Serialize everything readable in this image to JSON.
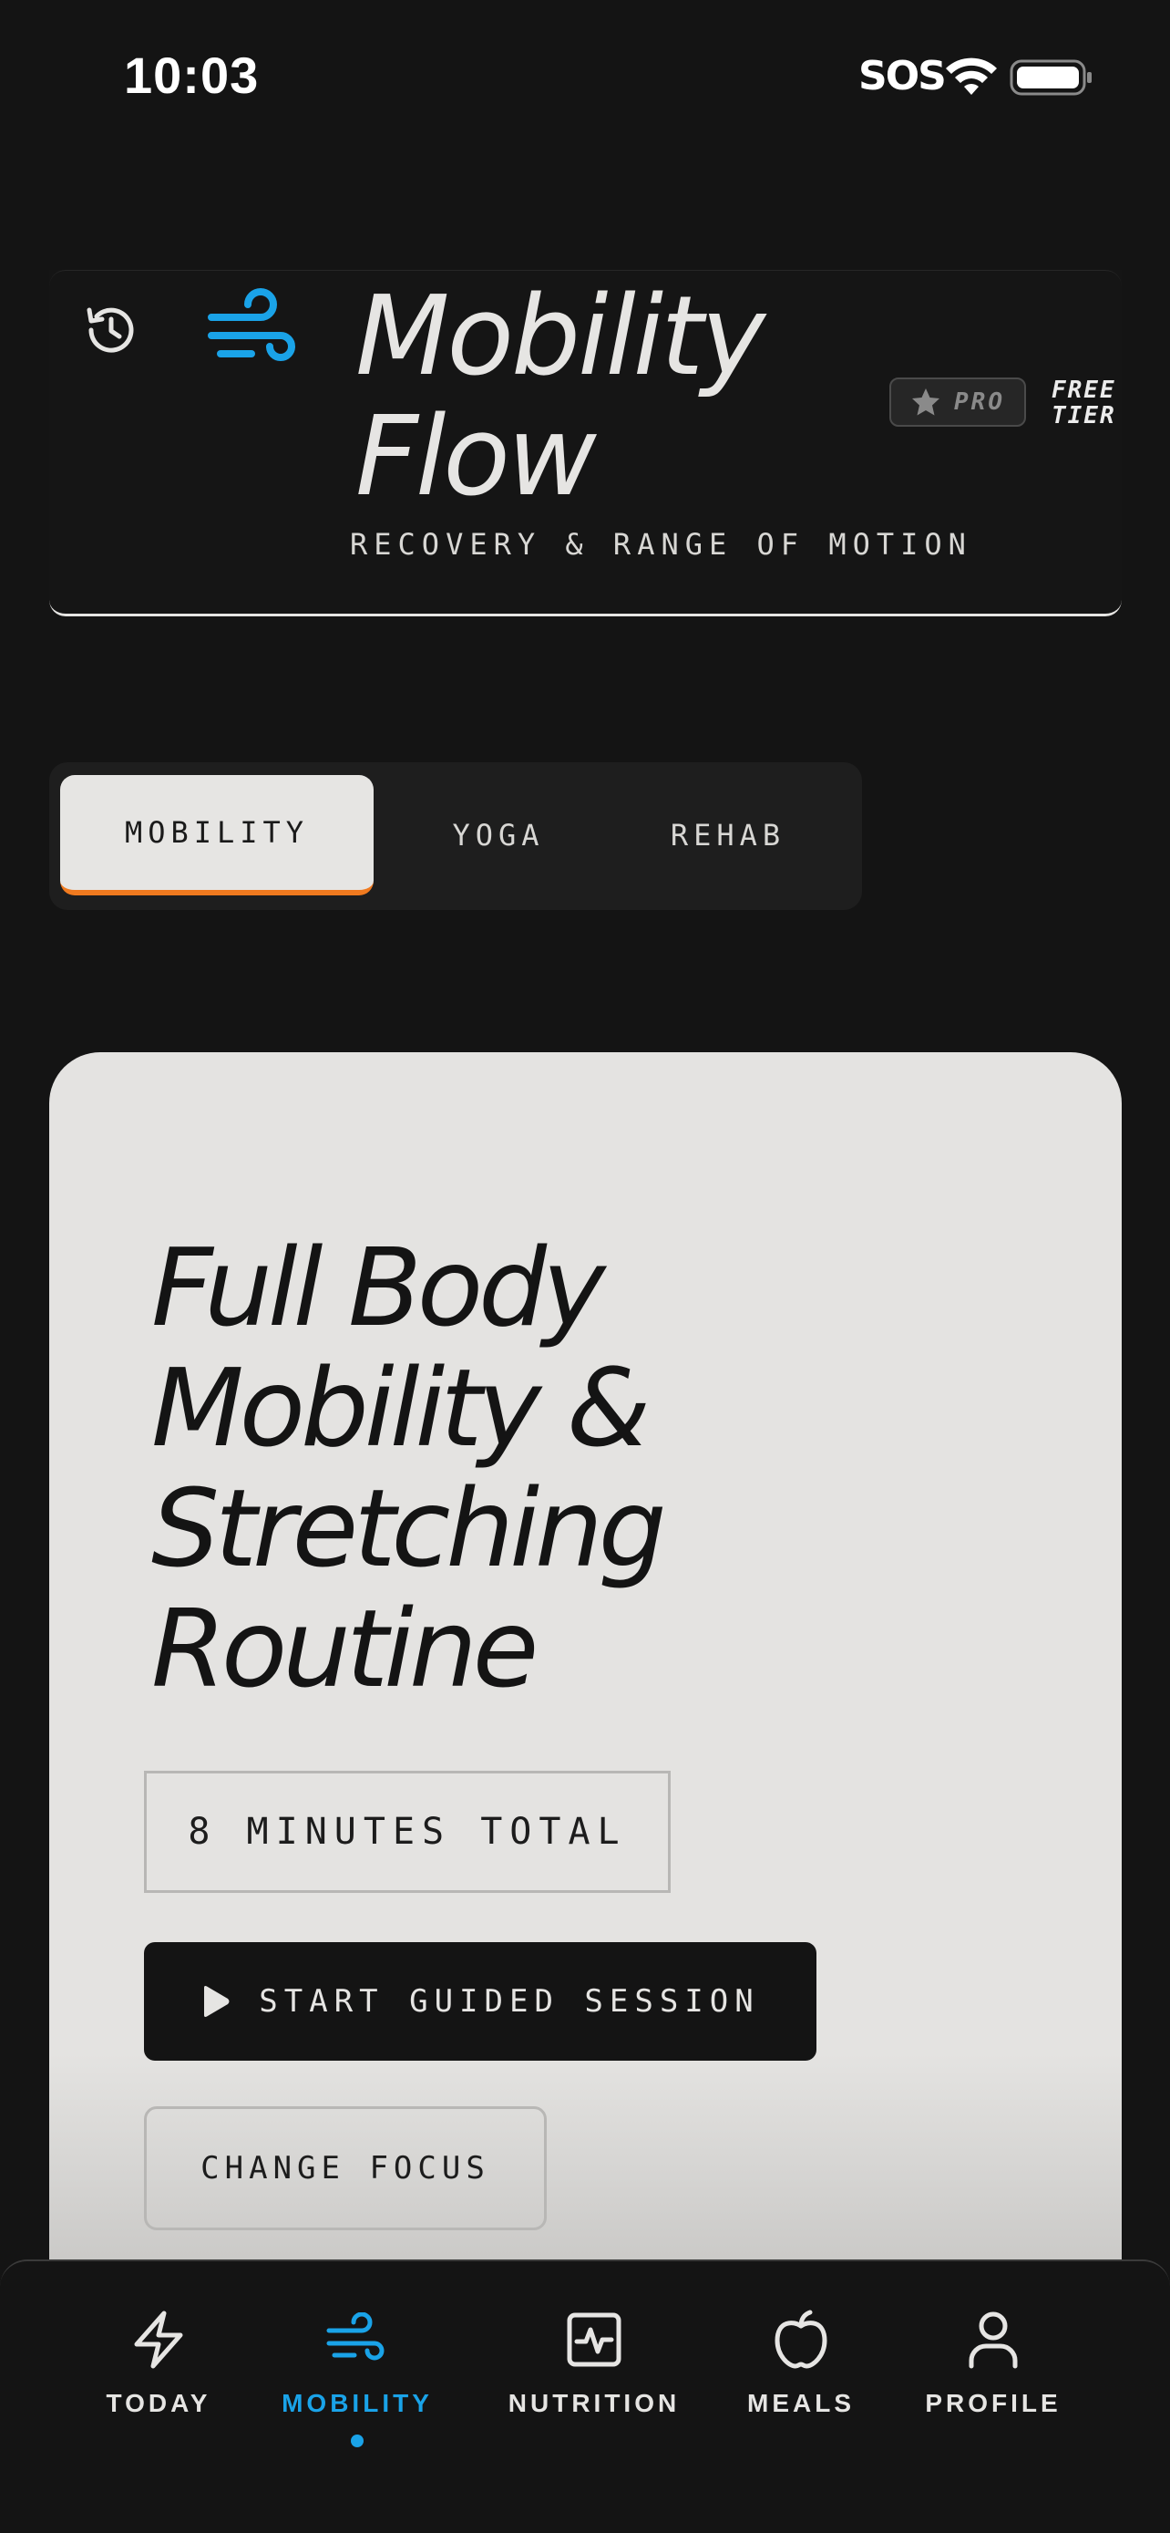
{
  "status_bar": {
    "time": "10:03",
    "sos": "SOS"
  },
  "header": {
    "title_line1": "Mobility",
    "title_line2": "Flow",
    "subtitle": "RECOVERY & RANGE OF MOTION",
    "pro_badge": "PRO",
    "tier_line1": "FREE",
    "tier_line2": "TIER"
  },
  "segments": {
    "items": [
      "MOBILITY",
      "YOGA",
      "REHAB"
    ],
    "active": "MOBILITY"
  },
  "routine": {
    "title_lines": [
      "Full Body",
      "Mobility &",
      "Stretching",
      "Routine"
    ],
    "duration": "8 MINUTES TOTAL",
    "start_label": "START GUIDED SESSION",
    "change_label": "CHANGE FOCUS"
  },
  "nav": {
    "items": [
      {
        "label": "TODAY",
        "icon": "bolt-icon"
      },
      {
        "label": "MOBILITY",
        "icon": "wind-icon"
      },
      {
        "label": "NUTRITION",
        "icon": "activity-icon"
      },
      {
        "label": "MEALS",
        "icon": "apple-icon"
      },
      {
        "label": "PROFILE",
        "icon": "user-icon"
      }
    ],
    "active": "MOBILITY"
  },
  "colors": {
    "accent": "#1aa3e8",
    "segment_underline": "#f07a1f",
    "background": "#141414",
    "card": "#e4e3e1"
  }
}
